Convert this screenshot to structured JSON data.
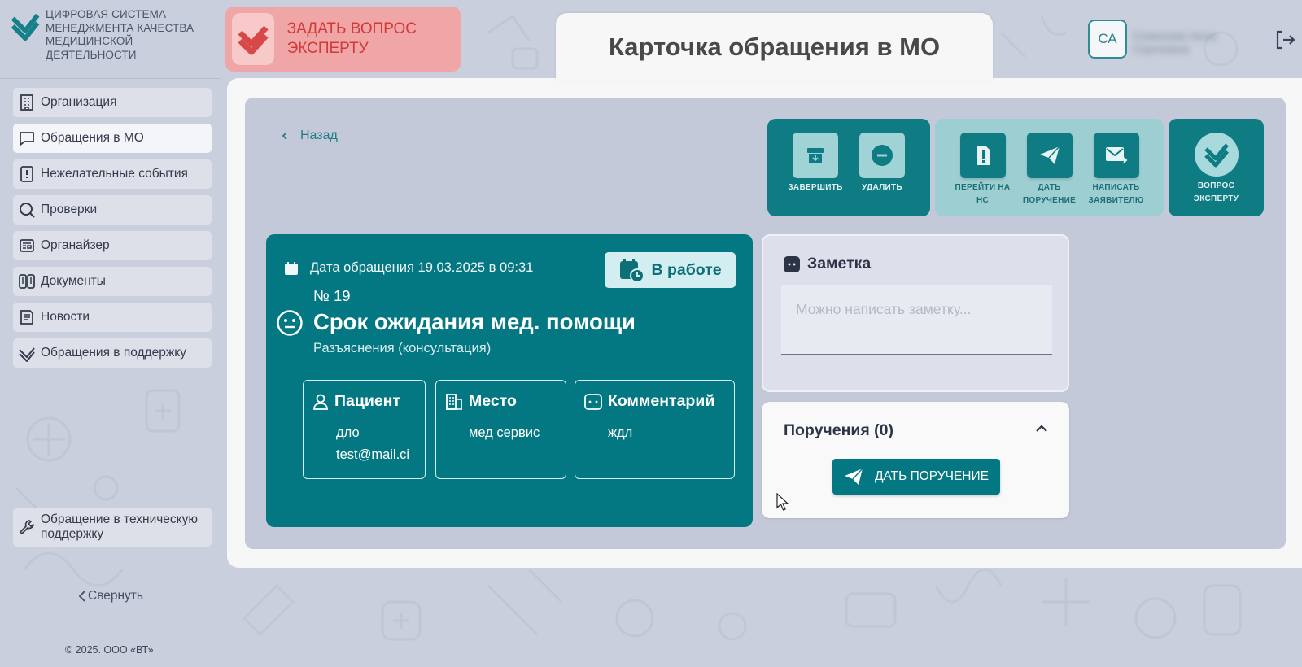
{
  "app": {
    "logo_text": "ЦИФРОВАЯ СИСТЕМА МЕНЕДЖМЕНТА КАЧЕСТВА МЕДИЦИНСКОЙ ДЕЯТЕЛЬНОСТИ",
    "ask_expert": "ЗАДАТЬ ВОПРОС ЭКСПЕРТУ"
  },
  "page": {
    "title": "Карточка обращения в МО"
  },
  "user": {
    "initials": "СА",
    "name": "Семенова Анна Сергеевна"
  },
  "sidebar": {
    "items": [
      {
        "label": "Организация",
        "icon": "building-icon"
      },
      {
        "label": "Обращения в МО",
        "icon": "chat-icon",
        "active": true
      },
      {
        "label": "Нежелательные события",
        "icon": "book-alert-icon"
      },
      {
        "label": "Проверки",
        "icon": "search-icon"
      },
      {
        "label": "Органайзер",
        "icon": "organizer-icon"
      },
      {
        "label": "Документы",
        "icon": "documents-icon"
      },
      {
        "label": "Новости",
        "icon": "news-icon"
      },
      {
        "label": "Обращения в поддержку",
        "icon": "support-check-icon"
      }
    ],
    "tech_support": "Обращение в техническую поддержку",
    "collapse": "Свернуть",
    "copyright": "© 2025. ООО «ВТ»"
  },
  "nav": {
    "back": "Назад"
  },
  "actions": {
    "complete": "ЗАВЕРШИТЬ",
    "delete": "УДАЛИТЬ",
    "go_ns": "ПЕРЕЙТИ НА НС",
    "give_task": "ДАТЬ ПОРУЧЕНИЕ",
    "write_applicant": "НАПИСАТЬ ЗАЯВИТЕЛЮ",
    "ask_expert": "ВОПРОС ЭКСПЕРТУ"
  },
  "case": {
    "date": "Дата обращения 19.03.2025 в 09:31",
    "status": "В работе",
    "number": "№ 19",
    "title": "Срок ожидания мед. помощи",
    "subtitle": "Разъяснения (консультация)",
    "patient_label": "Пациент",
    "patient_name": "дло",
    "patient_email": "test@mail.ci",
    "place_label": "Место",
    "place_value": "мед сервис",
    "comment_label": "Комментарий",
    "comment_value": "ждл"
  },
  "note": {
    "title": "Заметка",
    "placeholder": "Можно написать заметку..."
  },
  "tasks": {
    "title": "Поручения (0)",
    "button": "ДАТЬ ПОРУЧЕНИЕ"
  },
  "colors": {
    "teal": "#037882",
    "teal_light": "#9dcfd2",
    "background": "#c9cfdc",
    "accent_red": "#d23a3a"
  }
}
